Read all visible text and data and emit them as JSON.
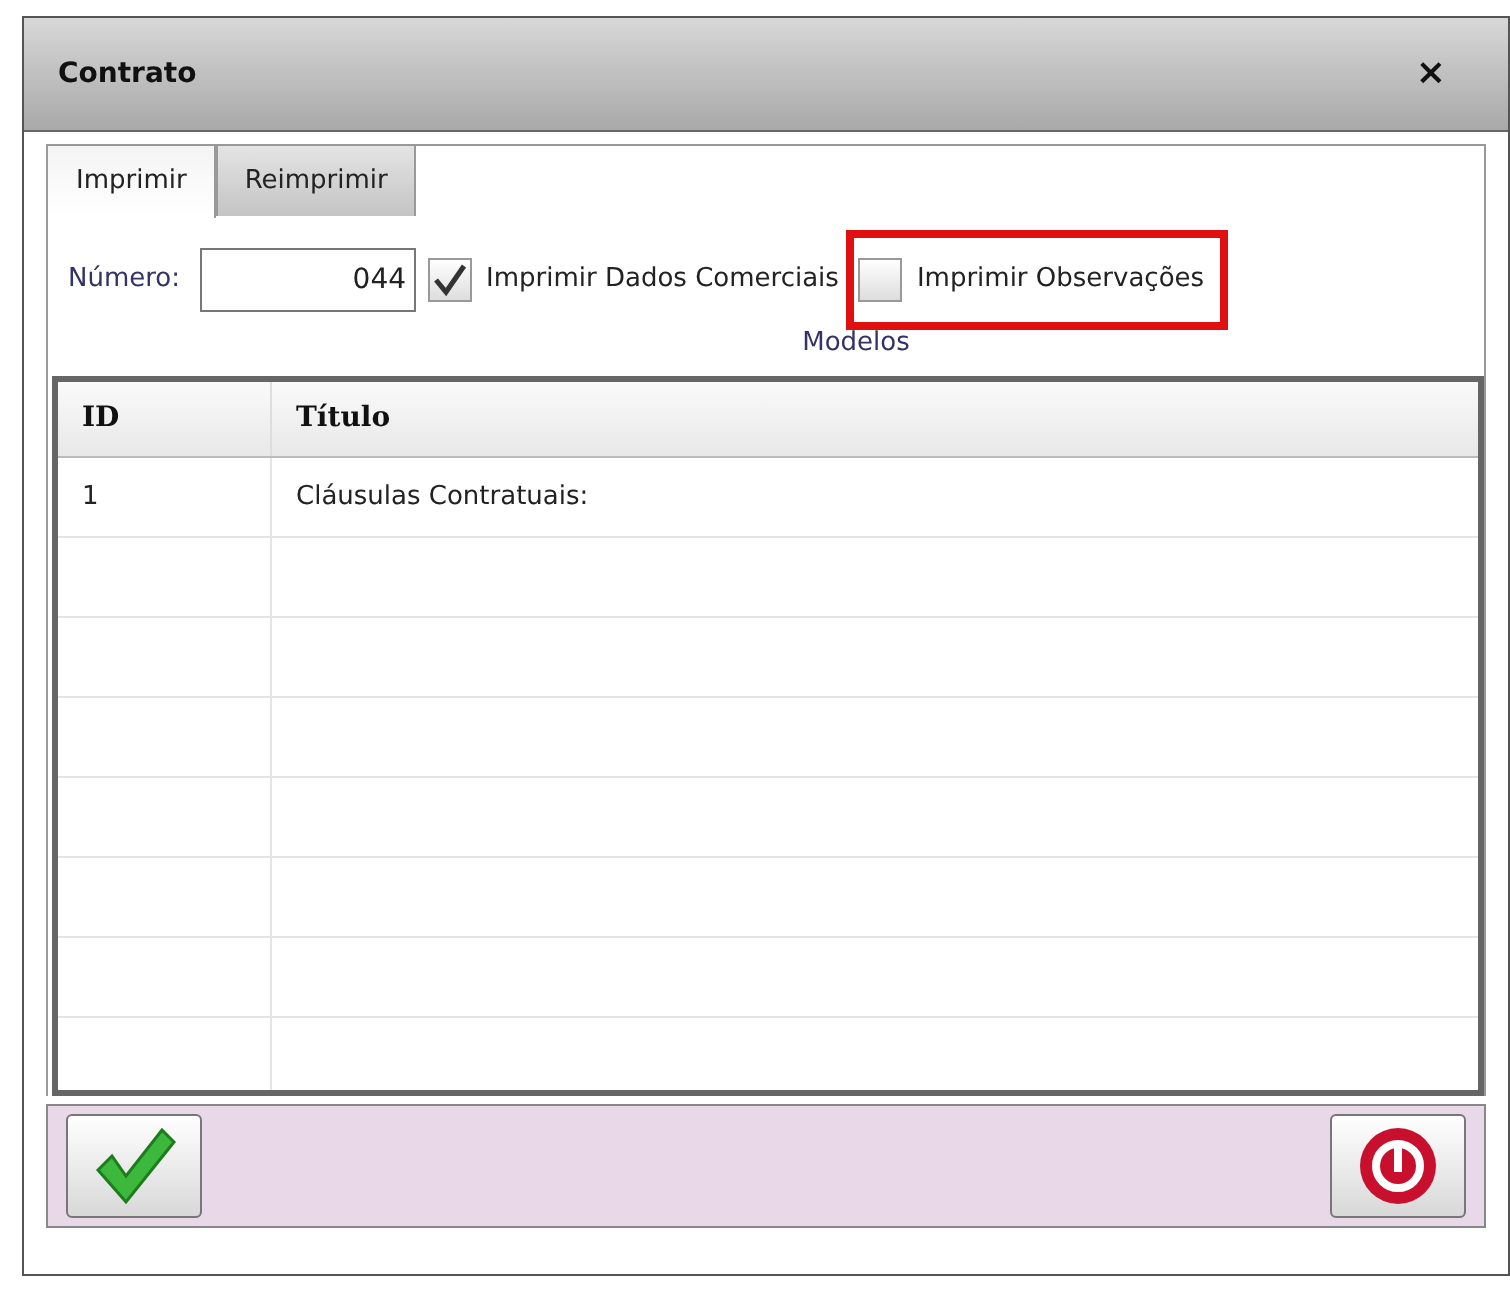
{
  "window": {
    "title": "Contrato",
    "close": "×"
  },
  "tabs": [
    {
      "label": "Imprimir",
      "selected": true
    },
    {
      "label": "Reimprimir",
      "selected": false
    }
  ],
  "numero": {
    "label": "Número:",
    "value": "044"
  },
  "options": [
    {
      "label": "Imprimir Dados Comerciais",
      "checked": true,
      "highlighted": false
    },
    {
      "label": "Imprimir Observações",
      "checked": false,
      "highlighted": true
    }
  ],
  "section_title": "Modelos",
  "table": {
    "columns": [
      "ID",
      "Título"
    ],
    "rows": [
      [
        "1",
        "Cláusulas Contratuais:"
      ]
    ]
  }
}
